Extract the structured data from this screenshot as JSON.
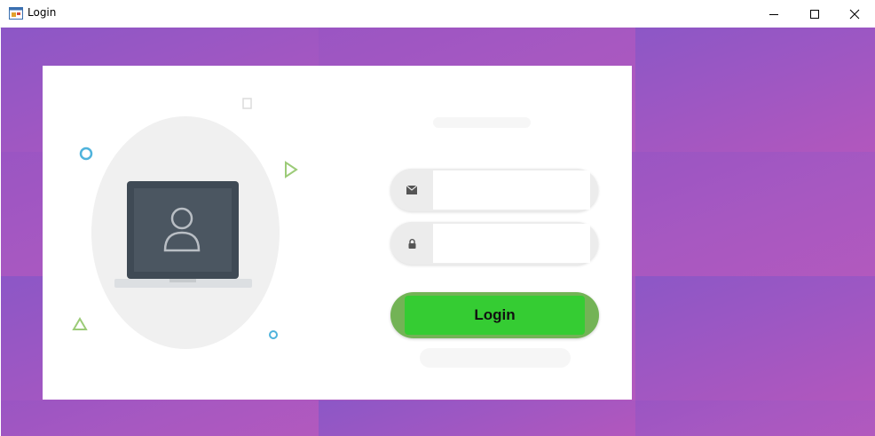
{
  "window": {
    "title": "Login",
    "controls": [
      "minimize",
      "maximize",
      "close"
    ]
  },
  "login_form": {
    "email_icon": "envelope-icon",
    "email_value": "",
    "password_icon": "lock-icon",
    "password_value": "",
    "submit_label": "Login"
  },
  "illustration": {
    "subject": "laptop-user-icon"
  },
  "colors": {
    "background_gradient_start": "#8c57c6",
    "background_gradient_end": "#b257bd",
    "card": "#ffffff",
    "button_outer": "#73b356",
    "button_inner": "#35cc33",
    "field_bg": "#ececec"
  }
}
